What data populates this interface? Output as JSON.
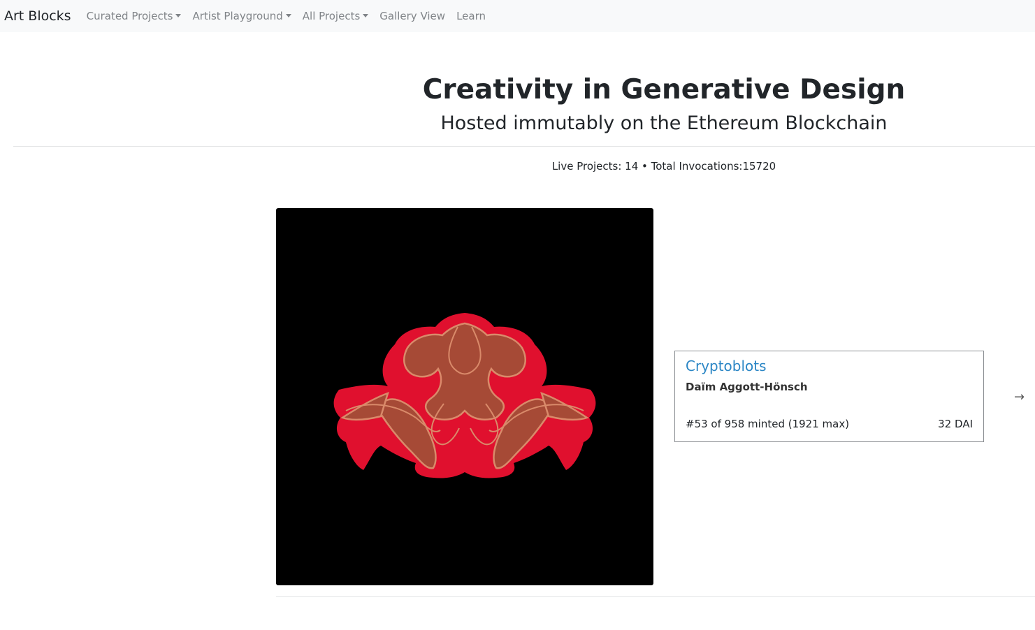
{
  "navbar": {
    "brand": "Art Blocks",
    "items": [
      {
        "label": "Curated Projects",
        "dropdown": true
      },
      {
        "label": "Artist Playground",
        "dropdown": true
      },
      {
        "label": "All Projects",
        "dropdown": true
      },
      {
        "label": "Gallery View",
        "dropdown": false
      },
      {
        "label": "Learn",
        "dropdown": false
      }
    ]
  },
  "hero": {
    "title": "Creativity in Generative Design",
    "subtitle": "Hosted immutably on the Ethereum Blockchain"
  },
  "stats": {
    "text": "Live Projects: 14 • Total Invocations:15720"
  },
  "featured": {
    "project_name": "Cryptoblots",
    "artist": "Daïm Aggott-Hönsch",
    "minted": "#53 of 958 minted (1921 max)",
    "price": "32 DAI"
  },
  "icons": {
    "next": "arrow-right-icon",
    "dropdown": "caret-down-icon"
  },
  "colors": {
    "navbar_bg": "#f8f9fa",
    "link": "#2b86c5",
    "art_bg": "#000000",
    "blot_red": "#e0102e",
    "blot_brown": "#a64a36"
  }
}
